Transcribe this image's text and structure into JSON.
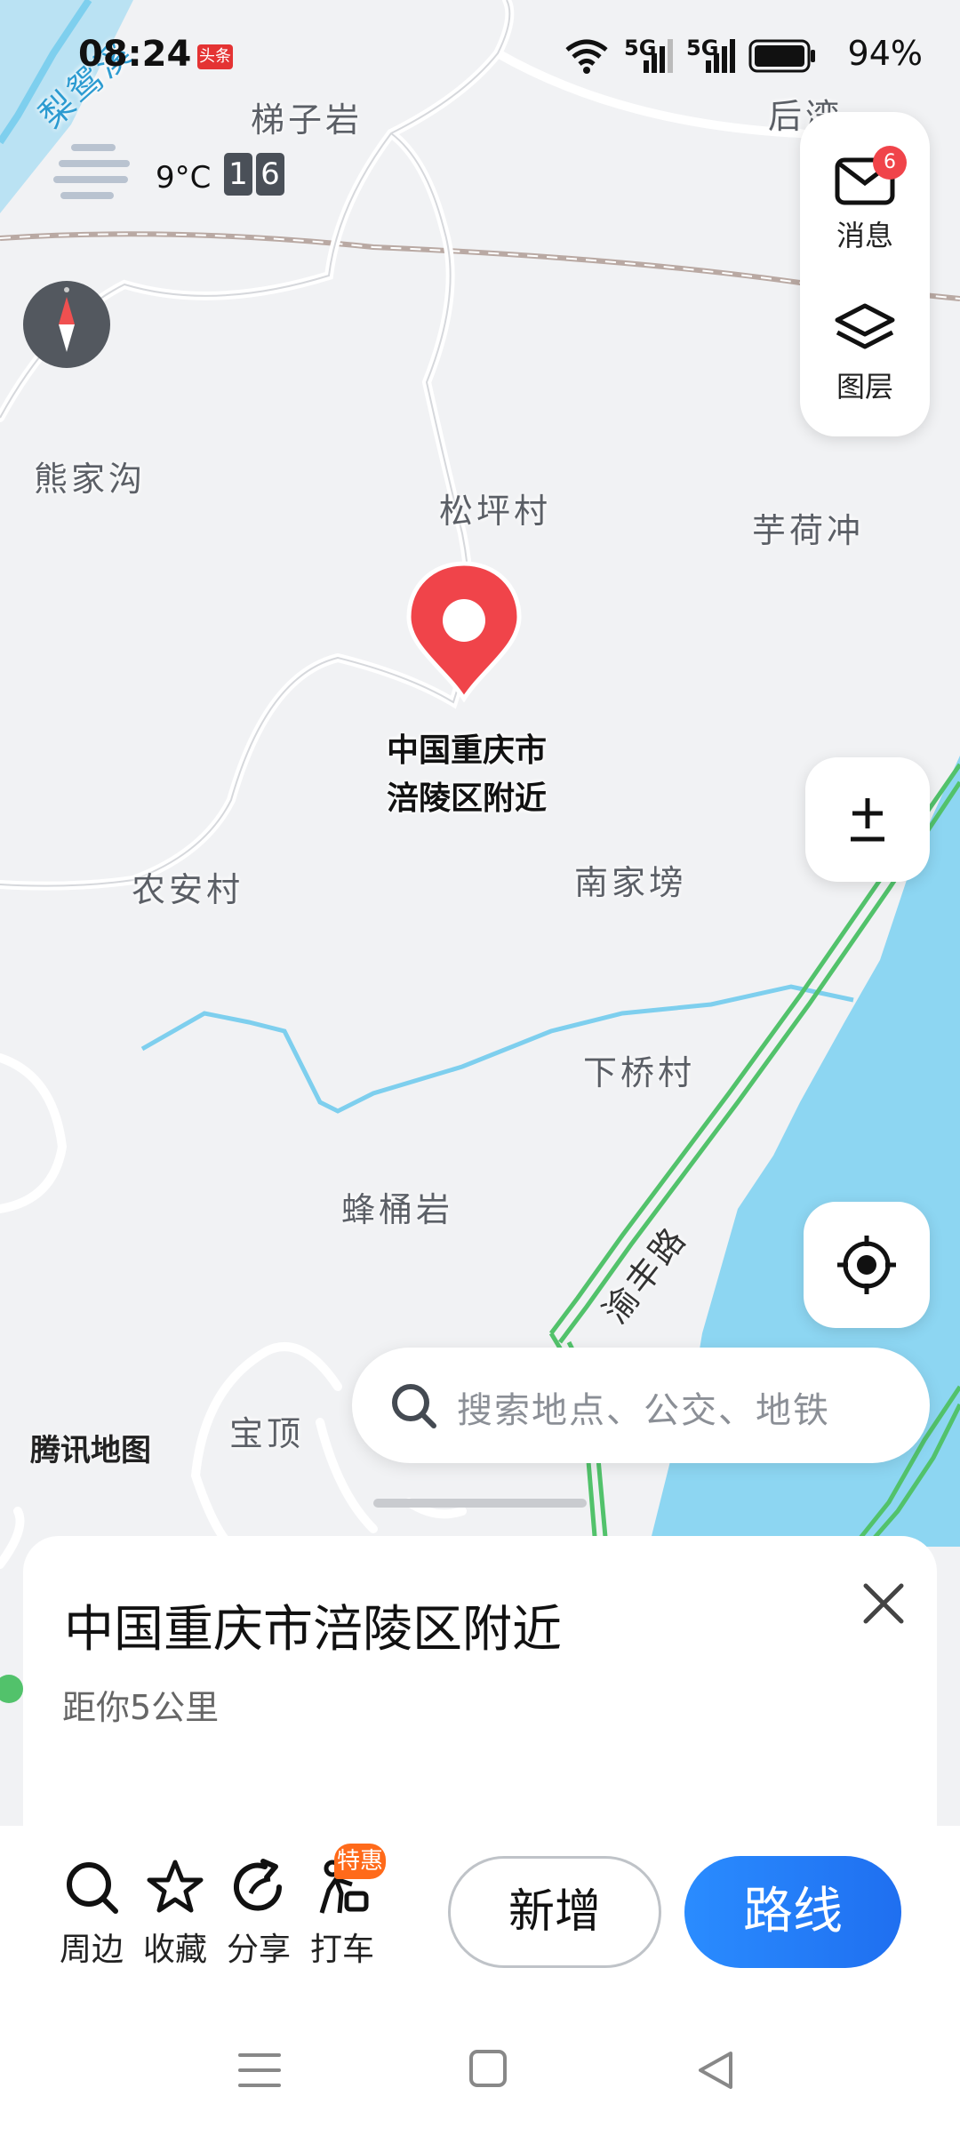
{
  "status_bar": {
    "time": "08:24",
    "news_badge": "头条",
    "signal1": "5G",
    "signal2": "5G",
    "battery": "94%"
  },
  "weather": {
    "temp": "9°C",
    "aqi_digits": [
      "1",
      "6"
    ]
  },
  "map": {
    "labels": {
      "tizi": "梯子岩",
      "houwan": "后湾",
      "xiongjiagou": "熊家沟",
      "songping": "松坪村",
      "yuhechong": "芋荷冲",
      "nongan": "农安村",
      "nanjia": "南家塝",
      "xiaqiao": "下桥村",
      "fengtong": "蜂桶岩",
      "baoding": "宝顶",
      "river": "梨鸳溪",
      "road": "渝丰路"
    },
    "provider": "腾讯地图"
  },
  "right_panel": {
    "messages_label": "消息",
    "messages_badge": "6",
    "layers_label": "图层"
  },
  "pin": {
    "label_line1": "中国重庆市",
    "label_line2": "涪陵区附近"
  },
  "search": {
    "placeholder": "搜索地点、公交、地铁"
  },
  "sheet": {
    "title": "中国重庆市涪陵区附近",
    "distance": "距你5公里"
  },
  "actions": {
    "nearby": "周边",
    "favorite": "收藏",
    "share": "分享",
    "taxi": "打车",
    "taxi_tag": "特惠",
    "add": "新增",
    "route": "路线"
  },
  "colors": {
    "accent": "#2a8cff",
    "pin": "#f0444a",
    "water": "#8dd6f2",
    "road_green": "#52c26b"
  }
}
